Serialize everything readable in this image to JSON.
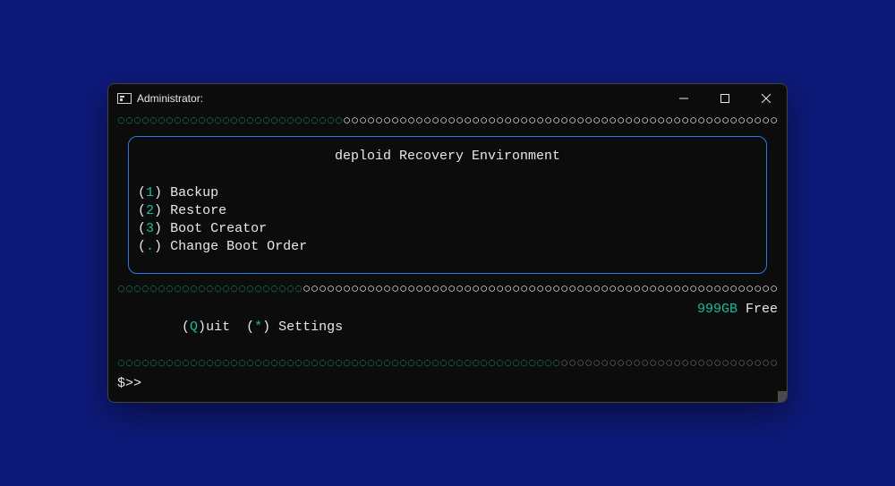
{
  "window": {
    "title": "Administrator:"
  },
  "ruler": {
    "char_fill": "◌",
    "char_dim": "○"
  },
  "box": {
    "title": "deploid Recovery Environment"
  },
  "menu": {
    "items": [
      {
        "key": "1",
        "label": "Backup"
      },
      {
        "key": "2",
        "label": "Restore"
      },
      {
        "key": "3",
        "label": "Boot Creator"
      },
      {
        "key": ".",
        "label": "Change Boot Order"
      }
    ]
  },
  "footer": {
    "quit_key": "Q",
    "quit_label": "uit",
    "settings_key": "*",
    "settings_label": "Settings",
    "disk_free_value": "999GB",
    "disk_free_label": " Free"
  },
  "prompt": "$>>"
}
